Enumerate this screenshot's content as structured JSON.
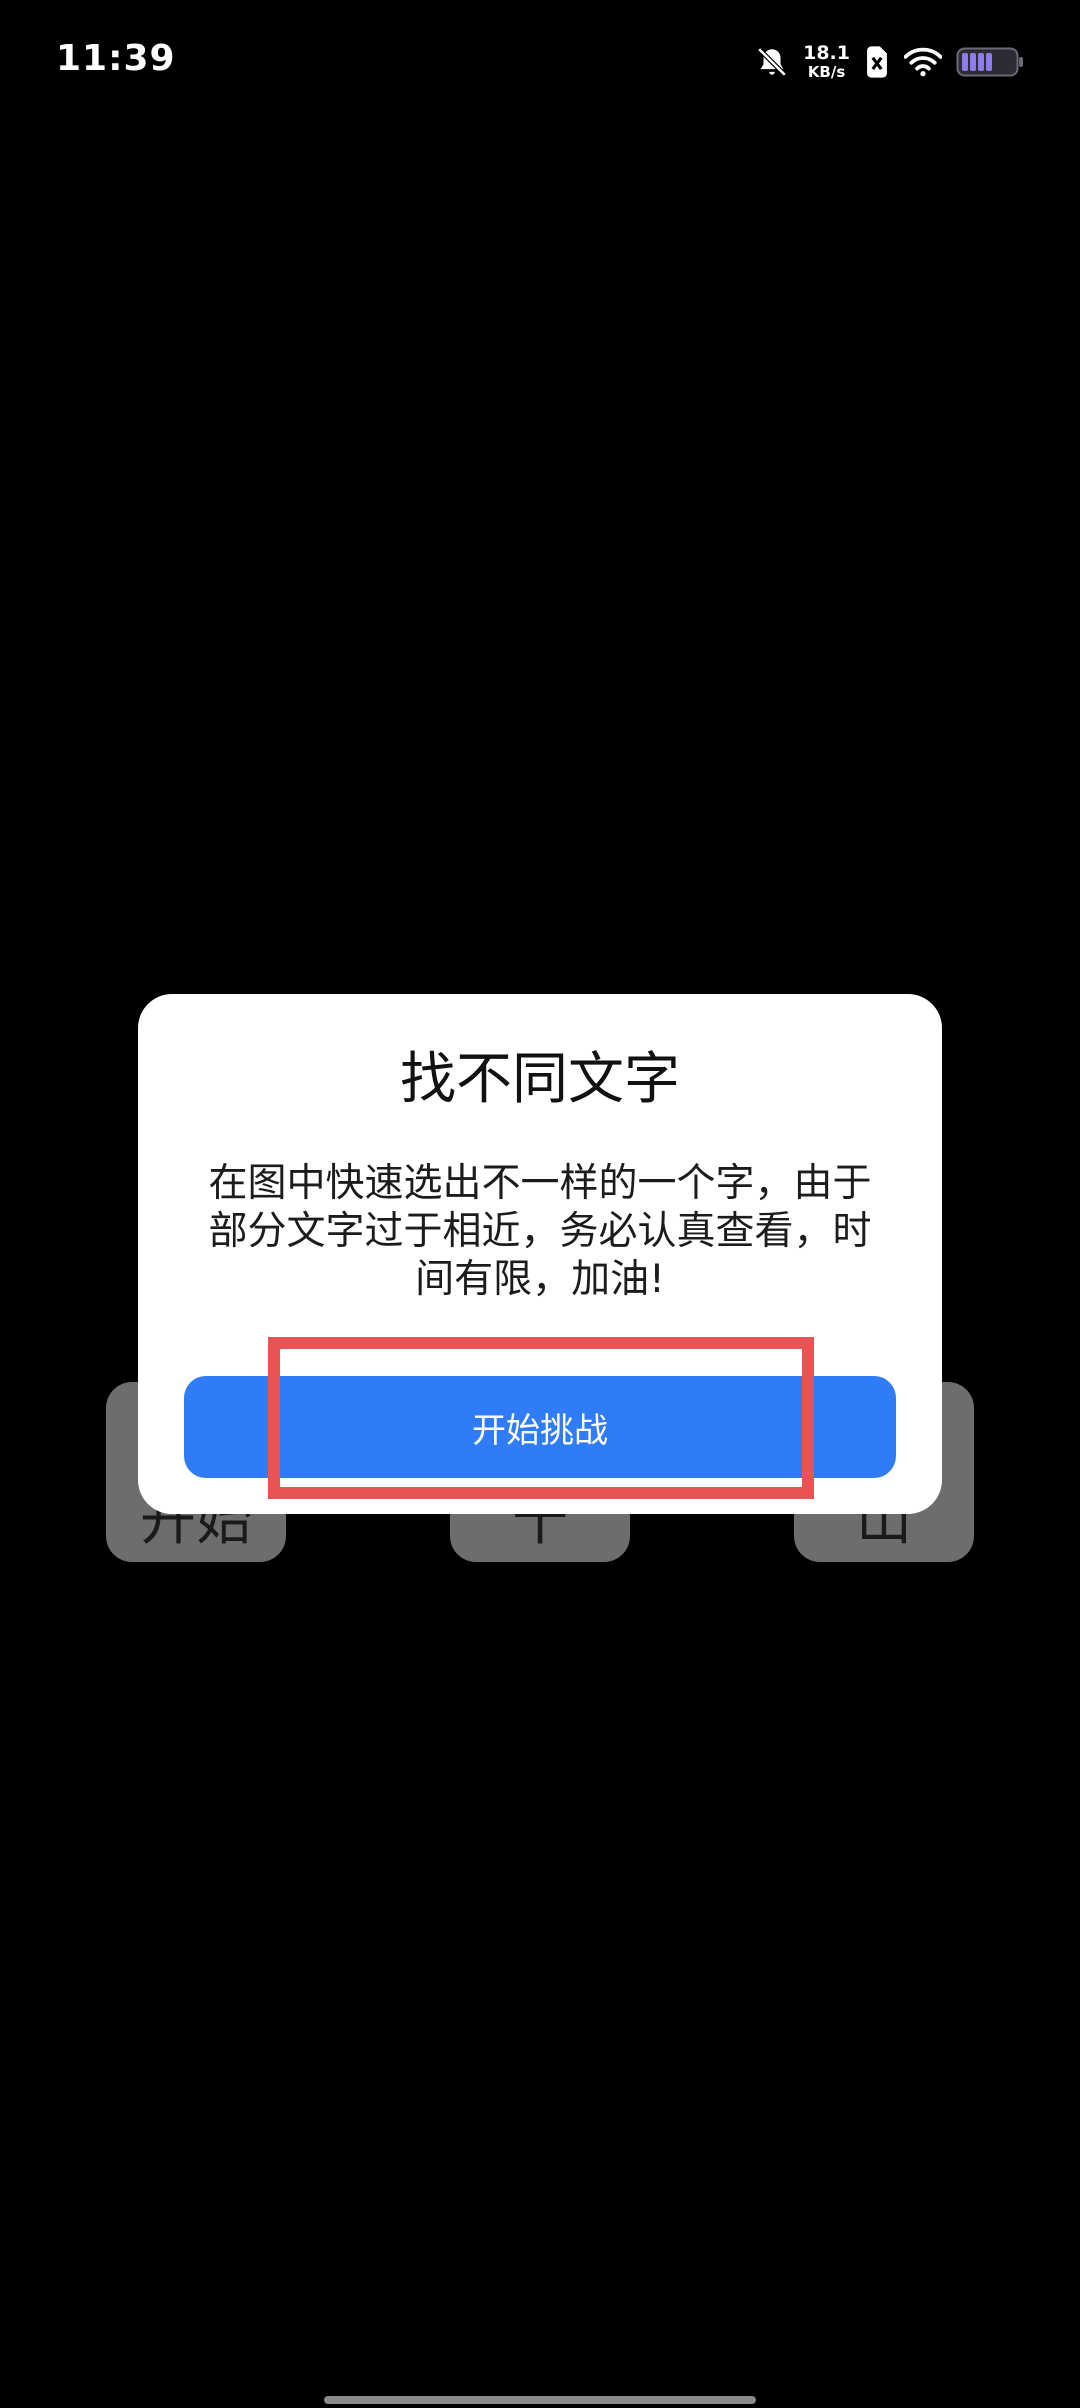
{
  "status_bar": {
    "time": "11:39",
    "net_speed_value": "18.1",
    "net_speed_unit": "KB/s",
    "icons": [
      "bell-muted-icon",
      "network-speed",
      "sim-blocked-icon",
      "wifi-icon",
      "battery-icon"
    ],
    "battery_color": "#8f7bf0"
  },
  "game_board": {
    "tiles": [
      {
        "text": "开始"
      },
      {
        "text": "十"
      },
      {
        "text": "山"
      }
    ]
  },
  "dialog": {
    "title": "找不同文字",
    "message_lines": [
      "在图中快速选出不一样的一个字，由于",
      "部分文字过于相近，务必认真查看，时",
      "间有限，加油!"
    ],
    "start_button_label": "开始挑战",
    "accent_color": "#2f7cf6"
  },
  "annotation": {
    "highlight_color": "#e85454"
  }
}
